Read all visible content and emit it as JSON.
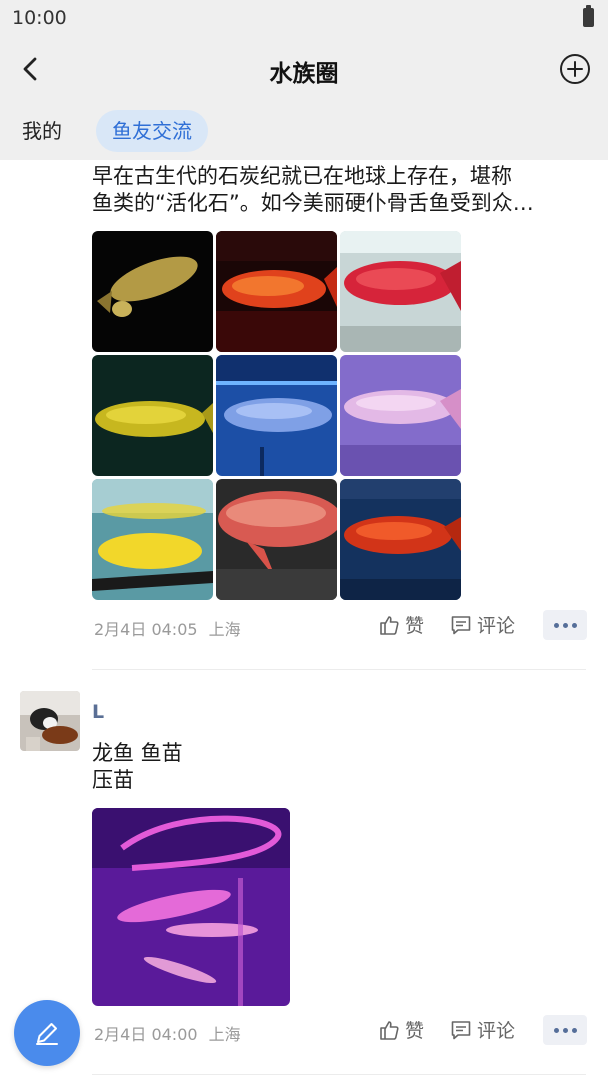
{
  "status_bar": {
    "time": "10:00"
  },
  "header": {
    "title": "水族圈"
  },
  "tabs": [
    {
      "label": "我的",
      "active": false
    },
    {
      "label": "鱼友交流",
      "active": true
    }
  ],
  "posts": [
    {
      "text_lines": [
        "早在古生代的石炭纪就已在地球上存在，堪称",
        "鱼类的“活化石”。如今美丽硬仆骨舌鱼受到众…"
      ],
      "image_count": 9,
      "time": "2月4日 04:05",
      "location": "上海",
      "like_label": "赞",
      "comment_label": "评论"
    },
    {
      "username": "L",
      "text_lines": [
        "龙鱼 鱼苗",
        "压苗"
      ],
      "image_count": 1,
      "time": "2月4日 04:00",
      "location": "上海",
      "like_label": "赞",
      "comment_label": "评论"
    }
  ],
  "colors": {
    "accent": "#2f6fd6",
    "fab": "#4a8bec",
    "username": "#5a6f95"
  }
}
